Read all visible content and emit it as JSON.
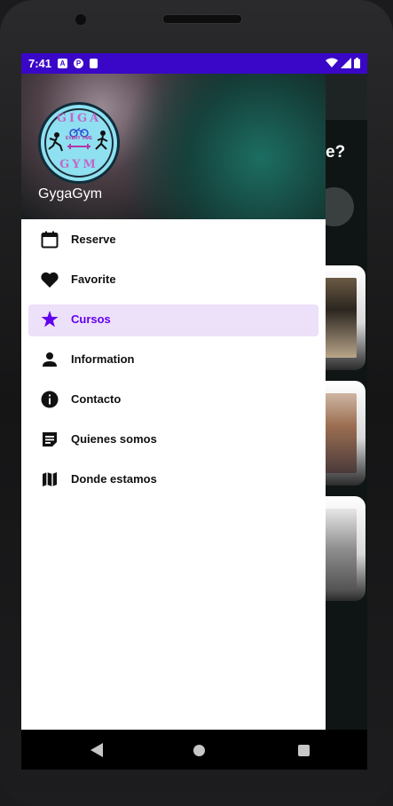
{
  "status_bar": {
    "time": "7:41",
    "icons": [
      "a-icon",
      "p-icon",
      "sd-card-icon"
    ],
    "right_icons": [
      "wifi-icon",
      "signal-icon",
      "battery-icon"
    ]
  },
  "background_app": {
    "question_fragment": "e?"
  },
  "drawer": {
    "brand_name": "GygaGym",
    "logo": {
      "top_text": "GIGA",
      "middle_text": "EVERY TIME",
      "bottom_text": "GYM"
    },
    "items": [
      {
        "label": "Reserve",
        "icon": "calendar-icon",
        "active": false
      },
      {
        "label": "Favorite",
        "icon": "heart-icon",
        "active": false
      },
      {
        "label": "Cursos",
        "icon": "star-icon",
        "active": true
      },
      {
        "label": "Information",
        "icon": "person-icon",
        "active": false
      },
      {
        "label": "Contacto",
        "icon": "info-icon",
        "active": false
      },
      {
        "label": "Quienes somos",
        "icon": "note-icon",
        "active": false
      },
      {
        "label": "Donde estamos",
        "icon": "map-icon",
        "active": false
      }
    ]
  },
  "colors": {
    "status_bar": "#3a07c8",
    "accent": "#6200ee",
    "active_bg": "#ede0f9"
  }
}
